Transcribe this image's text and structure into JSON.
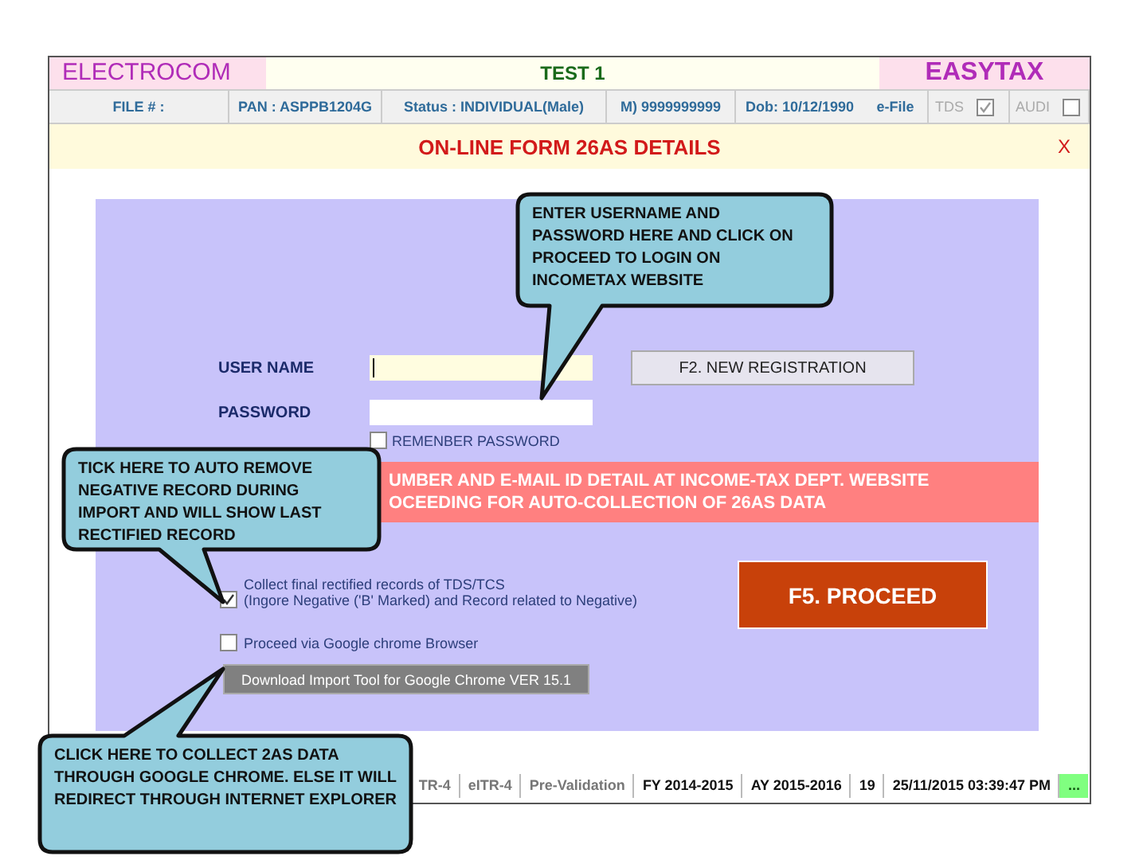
{
  "header": {
    "left": "ELECTROCOM",
    "center": "TEST 1",
    "right": "EASYTAX"
  },
  "info_bar": [
    {
      "kind": "text",
      "label": "FILE # :"
    },
    {
      "kind": "text",
      "label": "PAN : ASPPB1204G"
    },
    {
      "kind": "text",
      "label": "Status : INDIVIDUAL(Male)"
    },
    {
      "kind": "text",
      "label": "M) 9999999999"
    },
    {
      "kind": "text",
      "label": "Dob: 10/12/1990"
    },
    {
      "kind": "text",
      "label": "e-File"
    },
    {
      "kind": "check",
      "label": "TDS",
      "checked": true,
      "disabled": true
    },
    {
      "kind": "check",
      "label": "AUDI",
      "checked": false,
      "disabled": true
    }
  ],
  "dialog": {
    "title": "ON-LINE FORM 26AS DETAILS",
    "close": "X",
    "username_label": "USER NAME",
    "password_label": "PASSWORD",
    "register_button": "F2. NEW REGISTRATION",
    "remember": {
      "label": "REMENBER PASSWORD",
      "checked": false
    },
    "banner": [
      "UMBER AND E-MAIL ID DETAIL AT INCOME-TAX DEPT. WEBSITE",
      "OCEEDING FOR AUTO-COLLECTION OF 26AS DATA"
    ],
    "collect": {
      "label": "Collect final rectified records of TDS/TCS",
      "note": "(Ingore Negative ('B' Marked) and Record related to Negative)",
      "checked": true
    },
    "chrome": {
      "label": "Proceed via Google chrome Browser",
      "checked": false
    },
    "download_button": "Download Import Tool for Google Chrome VER 15.1",
    "proceed_button": "F5. PROCEED"
  },
  "status_bar": [
    {
      "text": "TR-4",
      "kind": "muted"
    },
    {
      "text": "eITR-4",
      "kind": "muted"
    },
    {
      "text": "Pre-Validation",
      "kind": "muted"
    },
    {
      "text": "FY 2014-2015",
      "kind": "bold"
    },
    {
      "text": "AY 2015-2016",
      "kind": "bold"
    },
    {
      "text": "19",
      "kind": "bold"
    },
    {
      "text": "25/11/2015 03:39:47 PM",
      "kind": "bold"
    },
    {
      "text": "...",
      "kind": "indicator"
    }
  ],
  "callouts": [
    "ENTER USERNAME AND PASSWORD HERE AND CLICK ON PROCEED TO LOGIN ON INCOMETAX WEBSITE",
    "TICK HERE TO AUTO REMOVE NEGATIVE RECORD DURING IMPORT AND WILL SHOW LAST RECTIFIED RECORD",
    "CLICK HERE TO COLLECT 2AS DATA THROUGH GOOGLE CHROME. ELSE IT WILL REDIRECT THROUGH INTERNET EXPLORER"
  ]
}
